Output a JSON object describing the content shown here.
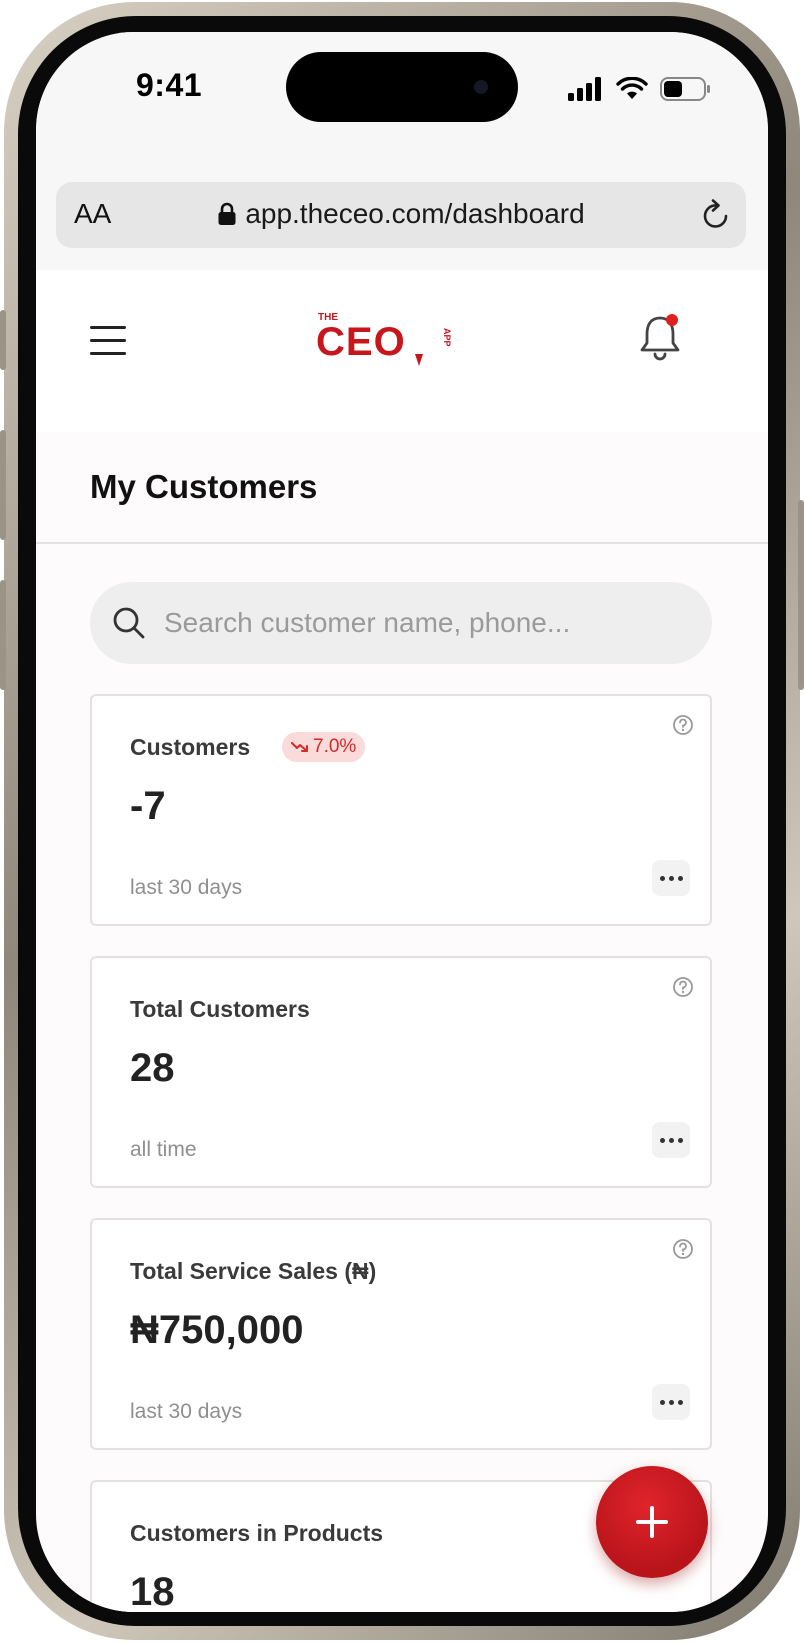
{
  "status_bar": {
    "time": "9:41"
  },
  "browser": {
    "text_size_label": "AA",
    "url": "app.theceo.com/dashboard"
  },
  "header": {
    "logo_small": "THE",
    "logo_main": "CEO",
    "logo_side": "APP"
  },
  "page": {
    "title": "My Customers"
  },
  "search": {
    "placeholder": "Search customer name, phone...",
    "value": ""
  },
  "cards": [
    {
      "label": "Customers",
      "value": "-7",
      "period": "last 30 days",
      "badge": "7.0%"
    },
    {
      "label": "Total Customers",
      "value": "28",
      "period": "all time"
    },
    {
      "label": "Total Service Sales (₦)",
      "value": "₦750,000",
      "period": "last 30 days"
    },
    {
      "label": "Customers in Products",
      "value": "18"
    }
  ],
  "colors": {
    "brand": "#c8161d",
    "badge_bg": "#fbdada",
    "badge_text": "#d12b2b",
    "notification_dot": "#e02020"
  },
  "icons": [
    "signal-icon",
    "wifi-icon",
    "battery-icon",
    "lock-icon",
    "reload-icon",
    "menu-icon",
    "bell-icon",
    "search-icon",
    "trend-down-icon",
    "help-icon",
    "more-icon",
    "plus-icon"
  ]
}
